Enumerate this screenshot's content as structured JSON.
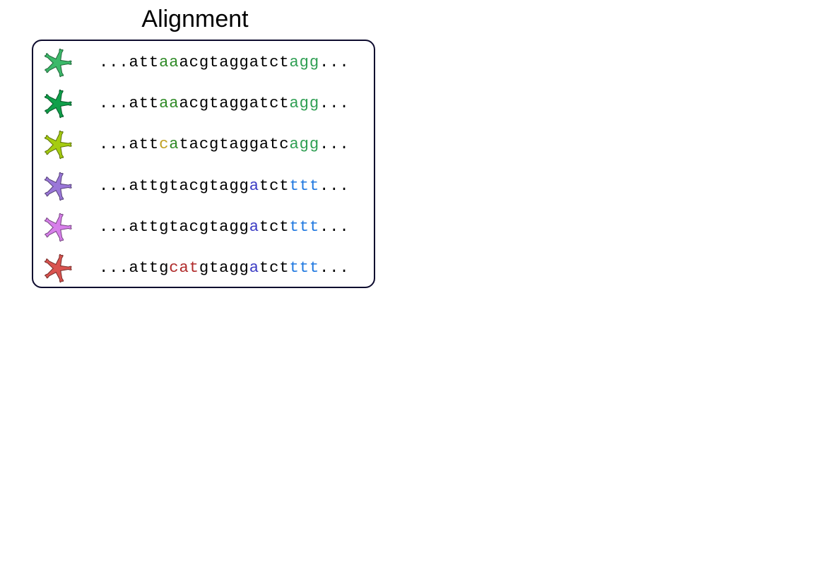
{
  "title": "Alignment",
  "rows": [
    {
      "icon": "organism-icon",
      "color": "#3cb96a",
      "segments": [
        {
          "text": "...att",
          "color": "#000000"
        },
        {
          "text": "aa",
          "color": "#2f8a26"
        },
        {
          "text": "acgtaggatct",
          "color": "#000000"
        },
        {
          "text": "agg",
          "color": "#2e9e52"
        },
        {
          "text": "...",
          "color": "#000000"
        }
      ]
    },
    {
      "icon": "organism-icon",
      "color": "#0fa04a",
      "segments": [
        {
          "text": "...att",
          "color": "#000000"
        },
        {
          "text": "aa",
          "color": "#2f8a26"
        },
        {
          "text": "acgtaggatct",
          "color": "#000000"
        },
        {
          "text": "agg",
          "color": "#2e9e52"
        },
        {
          "text": "...",
          "color": "#000000"
        }
      ]
    },
    {
      "icon": "organism-icon",
      "color": "#a5cc10",
      "segments": [
        {
          "text": "...att",
          "color": "#000000"
        },
        {
          "text": "c",
          "color": "#c0a020"
        },
        {
          "text": "a",
          "color": "#2f8a26"
        },
        {
          "text": "tacgtaggatc",
          "color": "#000000"
        },
        {
          "text": "agg",
          "color": "#2e9e52"
        },
        {
          "text": "...",
          "color": "#000000"
        }
      ]
    },
    {
      "icon": "organism-icon",
      "color": "#9a77d8",
      "segments": [
        {
          "text": "...attgtacgtagg",
          "color": "#000000"
        },
        {
          "text": "a",
          "color": "#3b3bc4"
        },
        {
          "text": "tct",
          "color": "#000000"
        },
        {
          "text": "ttt",
          "color": "#1f78e0"
        },
        {
          "text": "...",
          "color": "#000000"
        }
      ]
    },
    {
      "icon": "organism-icon",
      "color": "#d77fea",
      "segments": [
        {
          "text": "...attgtacgtagg",
          "color": "#000000"
        },
        {
          "text": "a",
          "color": "#3b3bc4"
        },
        {
          "text": "tct",
          "color": "#000000"
        },
        {
          "text": "ttt",
          "color": "#1f78e0"
        },
        {
          "text": "...",
          "color": "#000000"
        }
      ]
    },
    {
      "icon": "organism-icon",
      "color": "#d9534f",
      "segments": [
        {
          "text": "...attg",
          "color": "#000000"
        },
        {
          "text": "cat",
          "color": "#b02a2a"
        },
        {
          "text": "gtagg",
          "color": "#000000"
        },
        {
          "text": "a",
          "color": "#3b3bc4"
        },
        {
          "text": "tct",
          "color": "#000000"
        },
        {
          "text": "ttt",
          "color": "#1f78e0"
        },
        {
          "text": "...",
          "color": "#000000"
        }
      ]
    }
  ]
}
